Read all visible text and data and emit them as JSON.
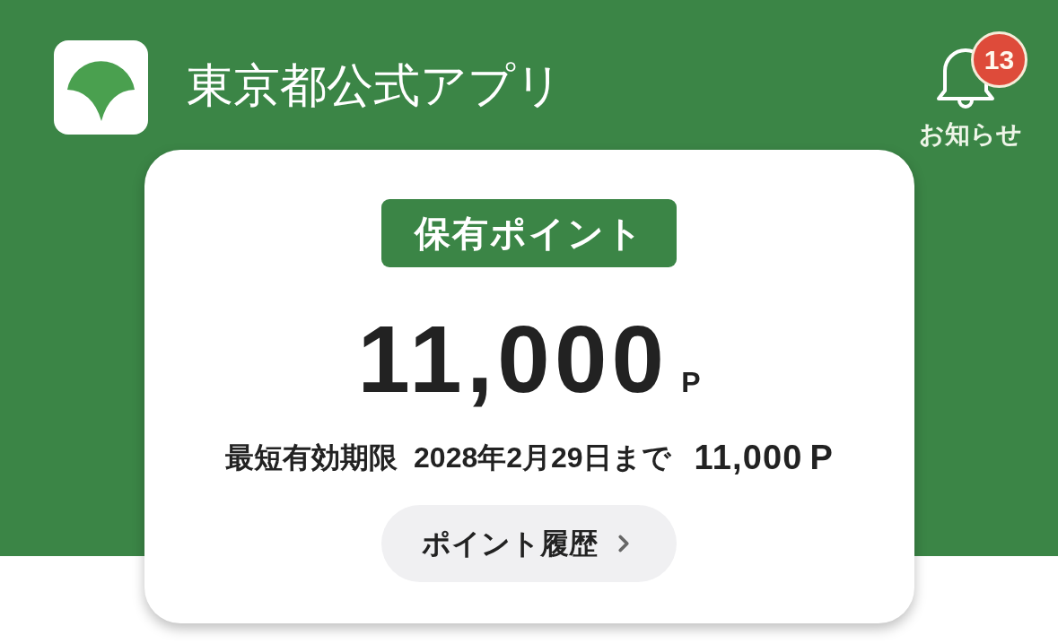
{
  "header": {
    "app_title": "東京都公式アプリ",
    "notifications": {
      "label": "お知らせ",
      "count": "13"
    }
  },
  "points_card": {
    "label": "保有ポイント",
    "balance": "11,000",
    "unit": "P",
    "expiry": {
      "label": "最短有効期限",
      "date": "2028年2月29日まで",
      "amount": "11,000",
      "unit": "P"
    },
    "history_button": {
      "label": "ポイント履歴"
    }
  }
}
